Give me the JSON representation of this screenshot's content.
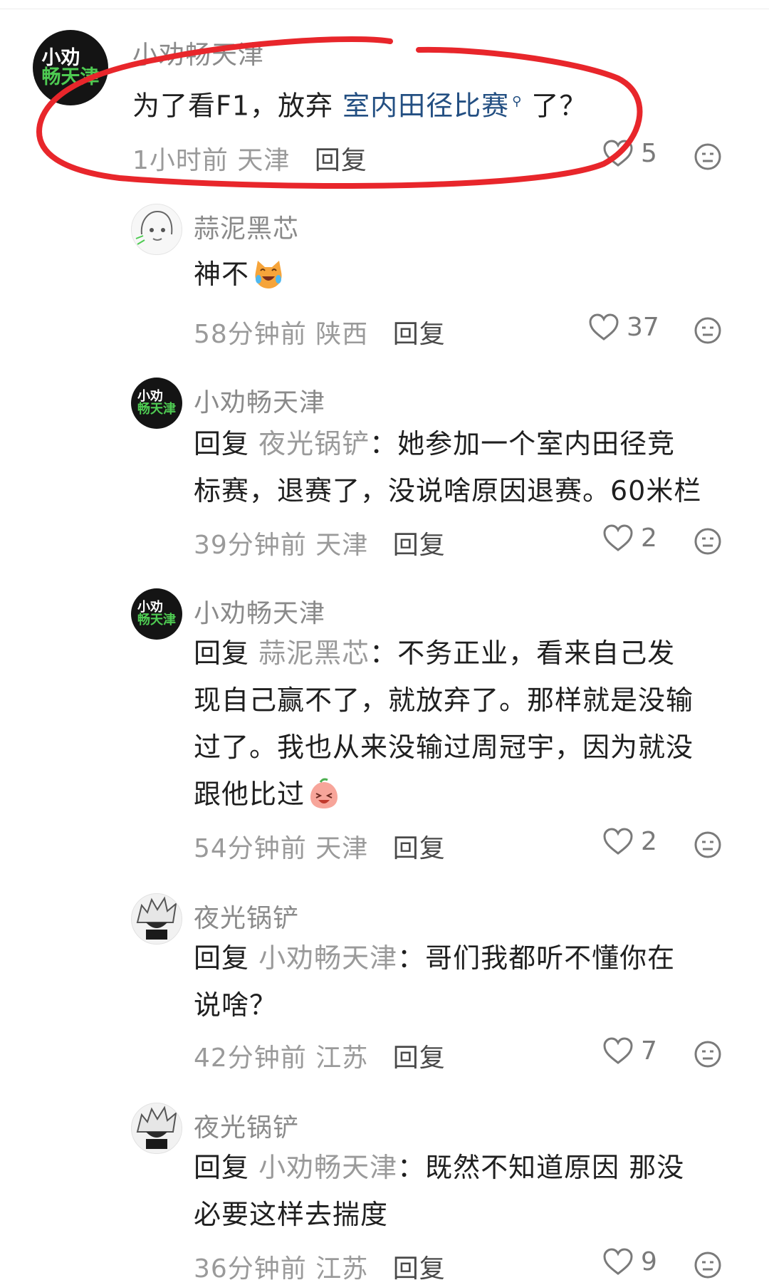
{
  "comments": [
    {
      "name": "小劝畅天津",
      "avatar_text": [
        "小劝",
        "畅天津"
      ],
      "pre": "为了看F1，放弃 ",
      "link": "室内田径比赛",
      "post": " 了？",
      "time": "1小时前",
      "region": "天津",
      "reply_label": "回复",
      "likes": "5"
    },
    {
      "name": "蒜泥黑芯",
      "text": "神不",
      "emoji": "cat-laugh-cry-emoji",
      "time": "58分钟前",
      "region": "陕西",
      "reply_label": "回复",
      "likes": "37"
    },
    {
      "name": "小劝畅天津",
      "avatar_text": [
        "小劝",
        "畅天津"
      ],
      "reply_prefix": "回复",
      "mention": "夜光锅铲",
      "lines": [
        "：她参加一个室内田径竞",
        "标赛，退赛了，没说啥原因退赛。60米栏"
      ],
      "time": "39分钟前",
      "region": "天津",
      "reply_label": "回复",
      "likes": "2"
    },
    {
      "name": "小劝畅天津",
      "avatar_text": [
        "小劝",
        "畅天津"
      ],
      "reply_prefix": "回复",
      "mention": "蒜泥黑芯",
      "lines": [
        "：不务正业，看来自己发",
        "现自己赢不了，就放弃了。那样就是没输",
        "过了。我也从来没输过周冠宇，因为就没",
        "跟他比过"
      ],
      "emoji": "laughing-peach-emoji",
      "time": "54分钟前",
      "region": "天津",
      "reply_label": "回复",
      "likes": "2"
    },
    {
      "name": "夜光锅铲",
      "reply_prefix": "回复",
      "mention": "小劝畅天津",
      "lines": [
        "：哥们我都听不懂你在",
        "说啥？"
      ],
      "time": "42分钟前",
      "region": "江苏",
      "reply_label": "回复",
      "likes": "7"
    },
    {
      "name": "夜光锅铲",
      "reply_prefix": "回复",
      "mention": "小劝畅天津",
      "lines": [
        "：既然不知道原因 那没",
        "必要这样去揣度"
      ],
      "time": "36分钟前",
      "region": "江苏",
      "reply_label": "回复",
      "likes": "9"
    }
  ],
  "colors": {
    "highlight_loop": "#e8262b",
    "link": "#234f82",
    "meta": "#9a9a9a"
  }
}
